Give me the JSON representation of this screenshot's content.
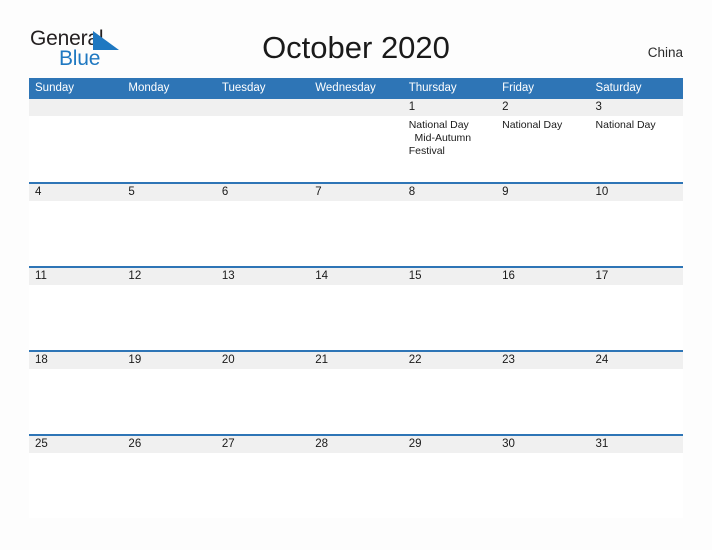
{
  "brand": {
    "name_top": "General",
    "name_bottom": "Blue",
    "accent_color": "#1f78c1",
    "text_color": "#231f20"
  },
  "header": {
    "title": "October 2020",
    "country": "China"
  },
  "theme": {
    "header_blue": "#2e75b6",
    "date_strip_gray": "#f0f0f0",
    "page_background": "#fdfdfd",
    "body_text": "#1a1a1a"
  },
  "calendar": {
    "month": "October",
    "year": "2020",
    "weekday_headers": [
      "Sunday",
      "Monday",
      "Tuesday",
      "Wednesday",
      "Thursday",
      "Friday",
      "Saturday"
    ],
    "weeks": [
      {
        "days": [
          {
            "date": "",
            "events": ""
          },
          {
            "date": "",
            "events": ""
          },
          {
            "date": "",
            "events": ""
          },
          {
            "date": "",
            "events": ""
          },
          {
            "date": "1",
            "events": "National Day\n  Mid-Autumn Festival"
          },
          {
            "date": "2",
            "events": "National Day"
          },
          {
            "date": "3",
            "events": "National Day"
          }
        ]
      },
      {
        "days": [
          {
            "date": "4",
            "events": ""
          },
          {
            "date": "5",
            "events": ""
          },
          {
            "date": "6",
            "events": ""
          },
          {
            "date": "7",
            "events": ""
          },
          {
            "date": "8",
            "events": ""
          },
          {
            "date": "9",
            "events": ""
          },
          {
            "date": "10",
            "events": ""
          }
        ]
      },
      {
        "days": [
          {
            "date": "11",
            "events": ""
          },
          {
            "date": "12",
            "events": ""
          },
          {
            "date": "13",
            "events": ""
          },
          {
            "date": "14",
            "events": ""
          },
          {
            "date": "15",
            "events": ""
          },
          {
            "date": "16",
            "events": ""
          },
          {
            "date": "17",
            "events": ""
          }
        ]
      },
      {
        "days": [
          {
            "date": "18",
            "events": ""
          },
          {
            "date": "19",
            "events": ""
          },
          {
            "date": "20",
            "events": ""
          },
          {
            "date": "21",
            "events": ""
          },
          {
            "date": "22",
            "events": ""
          },
          {
            "date": "23",
            "events": ""
          },
          {
            "date": "24",
            "events": ""
          }
        ]
      },
      {
        "days": [
          {
            "date": "25",
            "events": ""
          },
          {
            "date": "26",
            "events": ""
          },
          {
            "date": "27",
            "events": ""
          },
          {
            "date": "28",
            "events": ""
          },
          {
            "date": "29",
            "events": ""
          },
          {
            "date": "30",
            "events": ""
          },
          {
            "date": "31",
            "events": ""
          }
        ]
      }
    ]
  }
}
